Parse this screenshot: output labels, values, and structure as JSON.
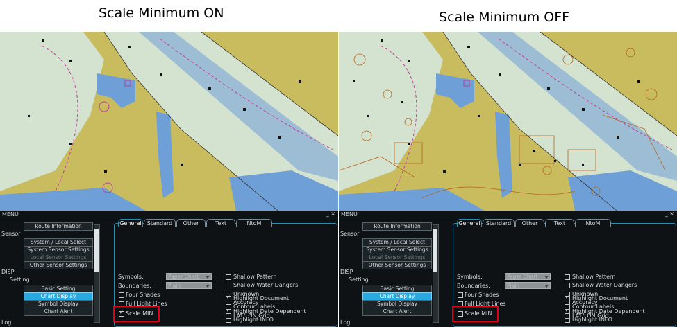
{
  "headings": {
    "left": "Scale Minimum ON",
    "right": "Scale Minimum OFF"
  },
  "colors": {
    "land": "#c8bc5e",
    "shallow": "#d4e2d0",
    "deep_blue": "#6e9fd6",
    "accent": "#2aa8e0",
    "highlight": "#e2001a",
    "menu_bg": "#0e1214"
  },
  "panels": [
    {
      "menu_title": "MENU",
      "window_controls": "_ ×",
      "tree": {
        "sensor": "Sensor",
        "route_information": "Route Information",
        "system_local_select": "System / Local Select",
        "system_sensor_settings": "System Sensor Settings",
        "local_sensor_settings": "Local Sensor Settings",
        "other_sensor_settings": "Other Sensor Settings",
        "disp": "DISP",
        "setting": "Setting",
        "basic_setting": "Basic Setting",
        "chart_display": "Chart Display",
        "symbol_display": "Symbol Display",
        "chart_alert": "Chart Alert",
        "log": "Log"
      },
      "tabs": [
        "General",
        "Standard",
        "Other",
        "Text",
        "NtoM"
      ],
      "symbols_label": "Symbols:",
      "symbols_value": "Paper Chart",
      "boundaries_label": "Boundaries:",
      "boundaries_value": "Plain",
      "left_checks": [
        {
          "label": "Four Shades",
          "checked": false
        },
        {
          "label": "Full Light Lines",
          "checked": false
        },
        {
          "label": "Scale MIN",
          "checked": true
        }
      ],
      "right_checks": [
        {
          "label": "Shallow Pattern",
          "checked": false
        },
        {
          "label": "Shallow Water Dangers",
          "checked": false
        },
        {
          "label": "Unknown",
          "checked": false
        },
        {
          "label": "Accuracy",
          "checked": false
        },
        {
          "label": "Highlight Date Dependent",
          "checked": true
        },
        {
          "label": "Highlight INFO",
          "checked": false
        },
        {
          "label": "Highlight Document",
          "checked": true
        },
        {
          "label": "Contour Labels",
          "checked": false
        },
        {
          "label": "LAT/LON Grid",
          "checked": false
        }
      ]
    },
    {
      "menu_title": "MENU",
      "window_controls": "_ ×",
      "tree": {
        "sensor": "Sensor",
        "route_information": "Route Information",
        "system_local_select": "System / Local Select",
        "system_sensor_settings": "System Sensor Settings",
        "local_sensor_settings": "Local Sensor Settings",
        "other_sensor_settings": "Other Sensor Settings",
        "disp": "DISP",
        "setting": "Setting",
        "basic_setting": "Basic Setting",
        "chart_display": "Chart Display",
        "symbol_display": "Symbol Display",
        "chart_alert": "Chart Alert",
        "log": "Log"
      },
      "tabs": [
        "General",
        "Standard",
        "Other",
        "Text",
        "NtoM"
      ],
      "symbols_label": "Symbols:",
      "symbols_value": "Paper Chart",
      "boundaries_label": "Boundaries:",
      "boundaries_value": "Plain",
      "left_checks": [
        {
          "label": "Four Shades",
          "checked": false
        },
        {
          "label": "Full Light Lines",
          "checked": false
        },
        {
          "label": "Scale MIN",
          "checked": false
        }
      ],
      "right_checks": [
        {
          "label": "Shallow Pattern",
          "checked": false
        },
        {
          "label": "Shallow Water Dangers",
          "checked": false
        },
        {
          "label": "Unknown",
          "checked": false
        },
        {
          "label": "Accuracy",
          "checked": false
        },
        {
          "label": "Highlight Date Dependent",
          "checked": true
        },
        {
          "label": "Highlight INFO",
          "checked": false
        },
        {
          "label": "Highlight Document",
          "checked": true
        },
        {
          "label": "Contour Labels",
          "checked": false
        },
        {
          "label": "LAT/LON Grid",
          "checked": false
        }
      ]
    }
  ]
}
